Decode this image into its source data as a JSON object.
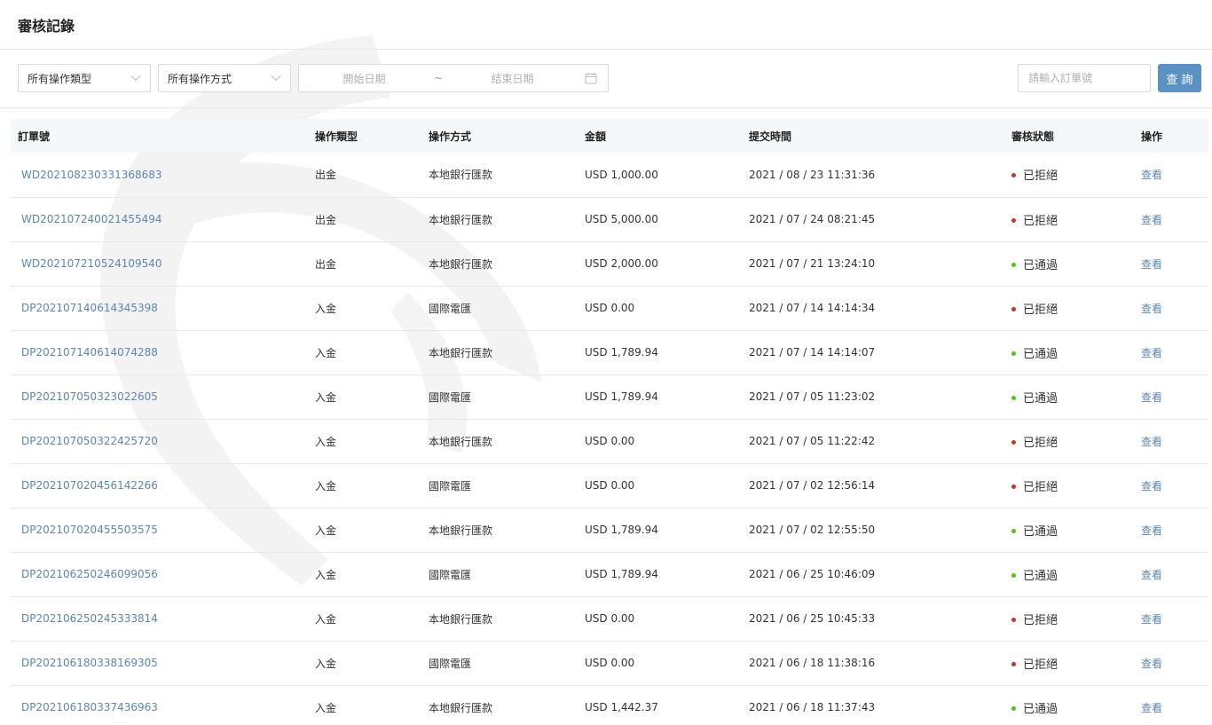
{
  "header": {
    "title": "審核記錄"
  },
  "filters": {
    "type_select": "所有操作類型",
    "method_select": "所有操作方式",
    "date_start_placeholder": "開始日期",
    "date_separator": "~",
    "date_end_placeholder": "結束日期",
    "order_placeholder": "請輸入訂單號",
    "search_label": "查 詢"
  },
  "table": {
    "columns": [
      "訂單號",
      "操作類型",
      "操作方式",
      "金額",
      "提交時間",
      "審核狀態",
      "操作"
    ],
    "rows": [
      {
        "order": "WD202108230331368683",
        "type": "出金",
        "method": "本地銀行匯款",
        "amount": "USD 1,000.00",
        "time": "2021 / 08 / 23 11:31:36",
        "status": "已拒絕",
        "status_key": "rejected",
        "action": "查看"
      },
      {
        "order": "WD202107240021455494",
        "type": "出金",
        "method": "本地銀行匯款",
        "amount": "USD 5,000.00",
        "time": "2021 / 07 / 24 08:21:45",
        "status": "已拒絕",
        "status_key": "rejected",
        "action": "查看"
      },
      {
        "order": "WD202107210524109540",
        "type": "出金",
        "method": "本地銀行匯款",
        "amount": "USD 2,000.00",
        "time": "2021 / 07 / 21 13:24:10",
        "status": "已通過",
        "status_key": "approved",
        "action": "查看"
      },
      {
        "order": "DP202107140614345398",
        "type": "入金",
        "method": "國際電匯",
        "amount": "USD 0.00",
        "time": "2021 / 07 / 14 14:14:34",
        "status": "已拒絕",
        "status_key": "rejected",
        "action": "查看"
      },
      {
        "order": "DP202107140614074288",
        "type": "入金",
        "method": "本地銀行匯款",
        "amount": "USD 1,789.94",
        "time": "2021 / 07 / 14 14:14:07",
        "status": "已通過",
        "status_key": "approved",
        "action": "查看"
      },
      {
        "order": "DP202107050323022605",
        "type": "入金",
        "method": "國際電匯",
        "amount": "USD 1,789.94",
        "time": "2021 / 07 / 05 11:23:02",
        "status": "已通過",
        "status_key": "approved",
        "action": "查看"
      },
      {
        "order": "DP202107050322425720",
        "type": "入金",
        "method": "本地銀行匯款",
        "amount": "USD 0.00",
        "time": "2021 / 07 / 05 11:22:42",
        "status": "已拒絕",
        "status_key": "rejected",
        "action": "查看"
      },
      {
        "order": "DP202107020456142266",
        "type": "入金",
        "method": "國際電匯",
        "amount": "USD 0.00",
        "time": "2021 / 07 / 02 12:56:14",
        "status": "已拒絕",
        "status_key": "rejected",
        "action": "查看"
      },
      {
        "order": "DP202107020455503575",
        "type": "入金",
        "method": "本地銀行匯款",
        "amount": "USD 1,789.94",
        "time": "2021 / 07 / 02 12:55:50",
        "status": "已通過",
        "status_key": "approved",
        "action": "查看"
      },
      {
        "order": "DP202106250246099056",
        "type": "入金",
        "method": "國際電匯",
        "amount": "USD 1,789.94",
        "time": "2021 / 06 / 25 10:46:09",
        "status": "已通過",
        "status_key": "approved",
        "action": "查看"
      },
      {
        "order": "DP202106250245333814",
        "type": "入金",
        "method": "本地銀行匯款",
        "amount": "USD 0.00",
        "time": "2021 / 06 / 25 10:45:33",
        "status": "已拒絕",
        "status_key": "rejected",
        "action": "查看"
      },
      {
        "order": "DP202106180338169305",
        "type": "入金",
        "method": "國際電匯",
        "amount": "USD 0.00",
        "time": "2021 / 06 / 18 11:38:16",
        "status": "已拒絕",
        "status_key": "rejected",
        "action": "查看"
      },
      {
        "order": "DP202106180337436963",
        "type": "入金",
        "method": "本地銀行匯款",
        "amount": "USD 1,442.37",
        "time": "2021 / 06 / 18 11:37:43",
        "status": "已通過",
        "status_key": "approved",
        "action": "查看"
      }
    ]
  },
  "colors": {
    "accent": "#5b91c3",
    "link": "#5b87b0",
    "rejected": "#c0392b",
    "approved": "#52c41a"
  },
  "icons": {
    "select_arrow": "chevron-down-icon",
    "calendar": "calendar-icon",
    "status": "status-dot-icon"
  }
}
